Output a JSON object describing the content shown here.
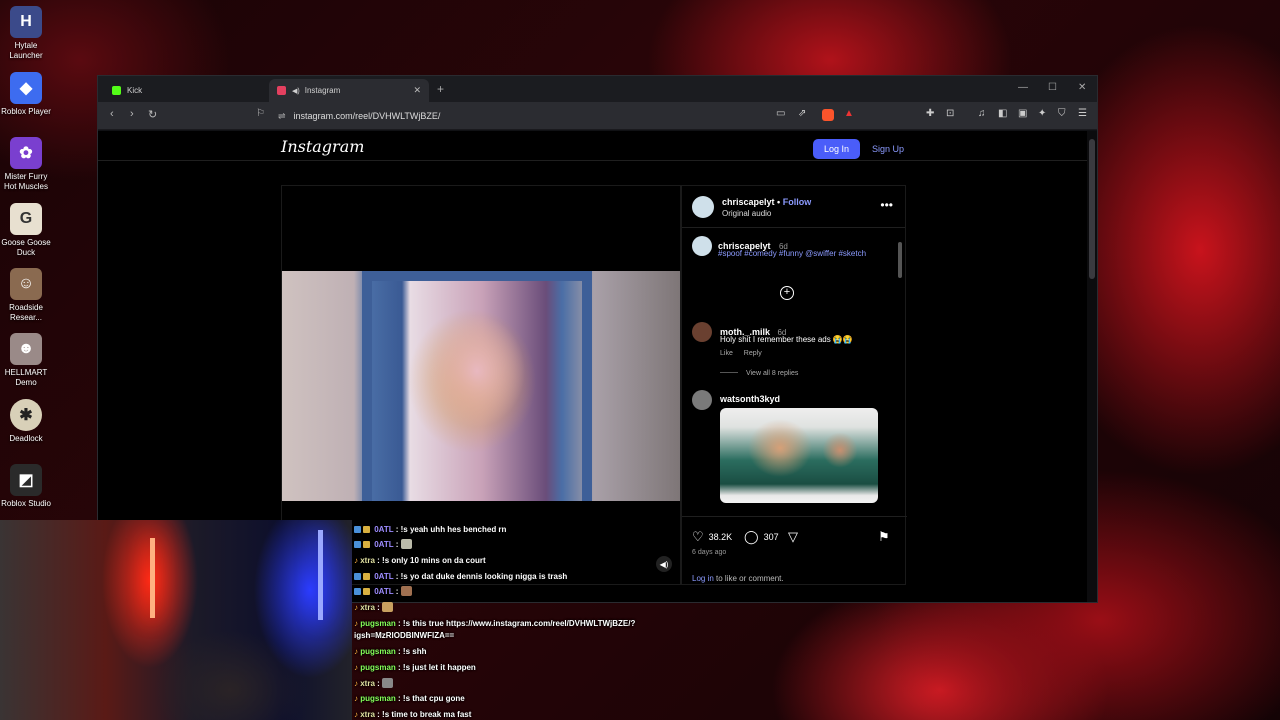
{
  "desktop": {
    "icons": [
      {
        "label": "Hytale Launcher",
        "icon": "hytale-icon",
        "color": "#3b4a8a"
      },
      {
        "label": "Roblox Player",
        "icon": "roblox-player-icon",
        "color": "#3d6cf0"
      },
      {
        "label": "Mister Furry Hot Muscles",
        "icon": "mister-furry-icon",
        "color": "#7a3fcf"
      },
      {
        "label": "Goose Goose Duck",
        "icon": "goose-icon",
        "color": "#e8e0d0"
      },
      {
        "label": "Roadside Resear...",
        "icon": "roadside-icon",
        "color": "#8a6a50"
      },
      {
        "label": "HELLMART Demo",
        "icon": "hellmart-icon",
        "color": "#9a8a88"
      },
      {
        "label": "Deadlock",
        "icon": "deadlock-icon",
        "color": "#d8d0b8"
      },
      {
        "label": "Roblox Studio",
        "icon": "roblox-studio-icon",
        "color": "#2a2a2a"
      }
    ]
  },
  "browser": {
    "tabs": [
      {
        "label": "Kick",
        "favicon_color": "#53fc18"
      },
      {
        "label": "Instagram",
        "favicon_color": "#e4405f"
      }
    ],
    "new_tab": "+",
    "url": "instagram.com/reel/DVHWLTWjBZE/"
  },
  "instagram": {
    "logo": "Instagram",
    "login_label": "Log In",
    "signup_label": "Sign Up",
    "post": {
      "author": "chriscapelyt",
      "follow_label": "Follow",
      "separator": "•",
      "audio": "Original audio",
      "caption_author": "chriscapelyt",
      "caption_time": "6d",
      "caption_tags": "#spoof #comedy #funny @swiffer #sketch",
      "comments": [
        {
          "user": "moth._.milk",
          "time": "6d",
          "text": "Holy shit I remember these ads 😭😭",
          "like_label": "Like",
          "reply_label": "Reply",
          "view_replies": "View all 8 replies"
        },
        {
          "user": "watsonth3kyd"
        }
      ],
      "likes": "38.2K",
      "comment_count": "307",
      "posted_ago": "6 days ago",
      "login_link": "Log in",
      "login_suffix": "to like or comment."
    }
  },
  "chat": {
    "messages": [
      {
        "user": "0ATL",
        "text": ": !s yeah uhh hes benched rn"
      },
      {
        "user": "0ATL",
        "text": ":"
      },
      {
        "user": "xtra",
        "text": ": !s only 10 mins on da court"
      },
      {
        "user": "0ATL",
        "text": ": !s yo dat duke dennis looking nigga is trash"
      },
      {
        "user": "0ATL",
        "text": ":"
      },
      {
        "user": "xtra",
        "text": ":"
      },
      {
        "user": "pugsman",
        "text": ": !s this true https://www.instagram.com/reel/DVHWLTWjBZE/?"
      },
      {
        "user": "",
        "text": "igsh=MzRlODBlNWFlZA=="
      },
      {
        "user": "pugsman",
        "text": ": !s shh"
      },
      {
        "user": "pugsman",
        "text": ": !s just let it happen"
      },
      {
        "user": "xtra",
        "text": ":"
      },
      {
        "user": "pugsman",
        "text": ": !s that cpu gone"
      },
      {
        "user": "xtra",
        "text": ": !s time to break ma fast"
      }
    ]
  }
}
